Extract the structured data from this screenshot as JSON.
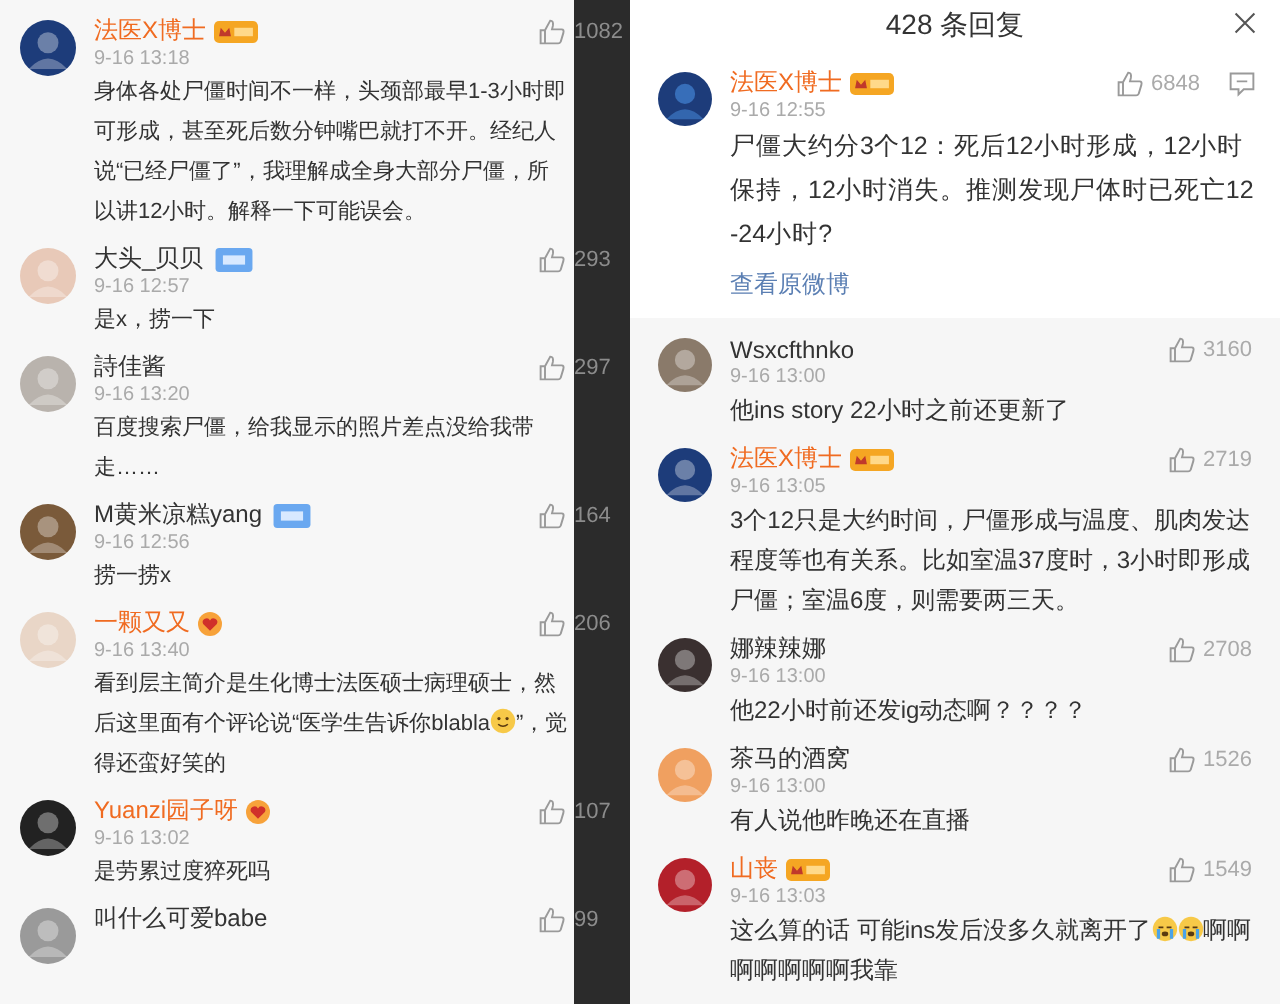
{
  "comment_list": {
    "comments": [
      {
        "name": "法医X博士",
        "vip": true,
        "badge": {
          "kind": "gold"
        },
        "date": "9-16 13:18",
        "likes": "1082",
        "body": [
          {
            "kind": "text",
            "text": "身体各处尸僵时间不一样，头颈部最早1-3小时即可形成，甚至死后数分钟嘴巴就打不开。经纪人说“已经尸僵了”，我理解成全身大部分尸僵，所以讲12小时。解释一下可能误会。"
          }
        ]
      },
      {
        "name": "大头_贝贝",
        "vip": false,
        "badge": {
          "kind": "blue"
        },
        "date": "9-16 12:57",
        "likes": "293",
        "body": [
          {
            "kind": "text",
            "text": "是x，捞一下"
          }
        ]
      },
      {
        "name": "詩佳酱",
        "vip": false,
        "date": "9-16 13:20",
        "likes": "297",
        "body": [
          {
            "kind": "text",
            "text": "百度搜索尸僵，给我显示的照片差点没给我带走……"
          }
        ]
      },
      {
        "name": "M黄米凉糕yang",
        "vip": false,
        "badge": {
          "kind": "blue"
        },
        "date": "9-16 12:56",
        "likes": "164",
        "body": [
          {
            "kind": "text",
            "text": "捞一捞x"
          }
        ]
      },
      {
        "name": "一颗又又",
        "vip": true,
        "badge": {
          "kind": "heart"
        },
        "date": "9-16 13:40",
        "likes": "206",
        "body": [
          {
            "kind": "text",
            "text": "看到层主简介是生化博士法医硕士病理硕士，然后这里面有个评论说“医学生告诉你blabla"
          },
          {
            "kind": "smile"
          },
          {
            "kind": "text",
            "text": "”，觉得还蛮好笑的"
          }
        ]
      },
      {
        "name": "Yuanzi园子呀",
        "vip": true,
        "badge": {
          "kind": "heart"
        },
        "date": "9-16 13:02",
        "likes": "107",
        "body": [
          {
            "kind": "text",
            "text": "是劳累过度猝死吗"
          }
        ]
      },
      {
        "name": "叫什么可爱babe",
        "vip": false,
        "likes": "99"
      }
    ]
  },
  "reply_sheet": {
    "title": "428 条回复",
    "original": {
      "name": "法医X博士",
      "vip": true,
      "badge": {
        "kind": "gold"
      },
      "date": "9-16 12:55",
      "likes": "6848",
      "body": [
        {
          "kind": "text",
          "text": "尸僵大约分3个12：死后12小时形成，12小时保持，12小时消失。推测发现尸体时已死亡12-24小时?"
        }
      ],
      "link": "查看原微博"
    },
    "replies": [
      {
        "name": "Wsxcfthnko",
        "vip": false,
        "date": "9-16 13:00",
        "likes": "3160",
        "body": [
          {
            "kind": "text",
            "text": "他ins story  22小时之前还更新了"
          }
        ]
      },
      {
        "name": "法医X博士",
        "vip": true,
        "badge": {
          "kind": "gold"
        },
        "date": "9-16 13:05",
        "likes": "2719",
        "body": [
          {
            "kind": "text",
            "text": "3个12只是大约时间，尸僵形成与温度、肌肉发达程度等也有关系。比如室温37度时，3小时即形成尸僵；室温6度，则需要两三天。"
          }
        ]
      },
      {
        "name": "娜辣辣娜",
        "vip": false,
        "date": "9-16 13:00",
        "likes": "2708",
        "body": [
          {
            "kind": "text",
            "text": "他22小时前还发ig动态啊？？？？"
          }
        ]
      },
      {
        "name": "茶马的酒窝",
        "vip": false,
        "date": "9-16 13:00",
        "likes": "1526",
        "body": [
          {
            "kind": "text",
            "text": "有人说他昨晚还在直播"
          }
        ]
      },
      {
        "name": "山丧",
        "vip": true,
        "badge": {
          "kind": "gold"
        },
        "date": "9-16 13:03",
        "likes": "1549",
        "body": [
          {
            "kind": "text",
            "text": "这么算的话 可能ins发后没多久就离开了"
          },
          {
            "kind": "cry"
          },
          {
            "kind": "cry"
          },
          {
            "kind": "text",
            "text": "啊啊啊啊啊啊啊我靠"
          }
        ]
      }
    ]
  }
}
